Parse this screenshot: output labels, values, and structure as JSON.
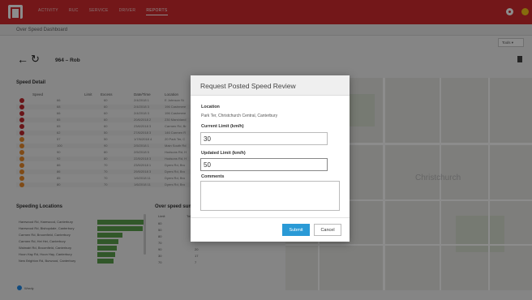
{
  "nav": {
    "items": [
      "ACTIVITY",
      "RUC",
      "SERVICE",
      "DRIVER",
      "REPORTS"
    ],
    "active_index": 4
  },
  "breadcrumb": "Over Speed Dashboard",
  "tools_label": "Tools",
  "vehicle": "964 – Rob",
  "speed_detail": {
    "title": "Speed Detail",
    "columns": [
      "",
      "Speed",
      "Limit",
      "Excess",
      "Date/Time",
      "Location"
    ],
    "rows": [
      {
        "speed": "66",
        "limit": "60",
        "date": "2/4/2018 1",
        "location": "E Johnson St",
        "color": "#c0272d"
      },
      {
        "speed": "68",
        "limit": "60",
        "date": "2/4/2018 3",
        "location": "196 Cashmere",
        "color": "#c0272d"
      },
      {
        "speed": "66",
        "limit": "60",
        "date": "2/4/2018 3",
        "location": "196 Cashmere",
        "color": "#c0272d"
      },
      {
        "speed": "65",
        "limit": "60",
        "date": "20/6/2018 2",
        "location": "230 Marshland",
        "color": "#c0272d"
      },
      {
        "speed": "65",
        "limit": "60",
        "date": "23/6/2018 3",
        "location": "Carmen Rd, Br",
        "color": "#c0272d"
      },
      {
        "speed": "62",
        "limit": "50",
        "date": "27/6/2018 3",
        "location": "146 Carmen R",
        "color": "#c0272d"
      },
      {
        "speed": "57",
        "limit": "50",
        "date": "1/7/6/2018 4",
        "location": "20 Park Ter, C",
        "color": "#e8892a"
      },
      {
        "speed": "100",
        "limit": "90",
        "date": "2/5/2018 1",
        "location": "Main South Rd",
        "color": "#e8892a"
      },
      {
        "speed": "90",
        "limit": "80",
        "date": "2/5/2018 5",
        "location": "Hudsons Rd, H",
        "color": "#e8892a"
      },
      {
        "speed": "92",
        "limit": "80",
        "date": "22/5/2018 3",
        "location": "Hudsons Rd, H",
        "color": "#e8892a"
      },
      {
        "speed": "86",
        "limit": "70",
        "date": "23/5/2018 1",
        "location": "Dyers Rd, Bro",
        "color": "#e8892a"
      },
      {
        "speed": "86",
        "limit": "70",
        "date": "29/5/2018 3",
        "location": "Dyers Rd, Bro",
        "color": "#e8892a"
      },
      {
        "speed": "85",
        "limit": "70",
        "date": "1/6/2018 11",
        "location": "Dyers Rd, Bro",
        "color": "#e8892a"
      },
      {
        "speed": "80",
        "limit": "70",
        "date": "1/6/2018 11",
        "location": "Dyers Rd, Bro",
        "color": "#e8892a"
      }
    ]
  },
  "speeding_locations": {
    "title": "Speeding Locations",
    "items": [
      {
        "label": "Harewood Rd, Harewood, Canterbury",
        "fraction": 1.0
      },
      {
        "label": "Harewood Rd, Bishopdale, Canterbury",
        "fraction": 0.98
      },
      {
        "label": "Carmen Rd, Broomfield, Canterbury",
        "fraction": 0.55
      },
      {
        "label": "Carmen Rd, Hei Hei, Canterbury",
        "fraction": 0.45
      },
      {
        "label": "Waimairi Rd, Broomfield, Canterbury",
        "fraction": 0.42
      },
      {
        "label": "Hoon Hay Rd, Hoon Hay, Canterbury",
        "fraction": 0.38
      },
      {
        "label": "New Brighton Rd, Burwood, Canterbury",
        "fraction": 0.35
      }
    ]
  },
  "over_speed": {
    "title": "Over speed sum",
    "col_limit": "Limit",
    "col_total": "Tot",
    "rows": [
      {
        "limit": "60",
        "total": ""
      },
      {
        "limit": "50",
        "total": ""
      },
      {
        "limit": "80",
        "total": ""
      },
      {
        "limit": "70",
        "total": ""
      },
      {
        "limit": "90",
        "total": "20"
      },
      {
        "limit": "30",
        "total": "17"
      },
      {
        "limit": "70",
        "total": "7"
      }
    ]
  },
  "checkbox_label": "Wnrdy",
  "map_city": "Christchurch",
  "modal": {
    "title": "Request Posted Speed Review",
    "location_label": "Location",
    "location_value": "Park Ter, Christchurch Central, Canterbury",
    "current_limit_label": "Current Limit (km/h)",
    "current_limit_value": "30",
    "updated_limit_label": "Updated Limit (km/h)",
    "updated_limit_value": "50",
    "comments_label": "Comments",
    "comments_value": "",
    "submit_label": "Submit",
    "cancel_label": "Cancel"
  },
  "colors": {
    "brand_red": "#d12b2e",
    "primary_blue": "#2a9ad6",
    "bar_green": "#5a9e4b"
  }
}
